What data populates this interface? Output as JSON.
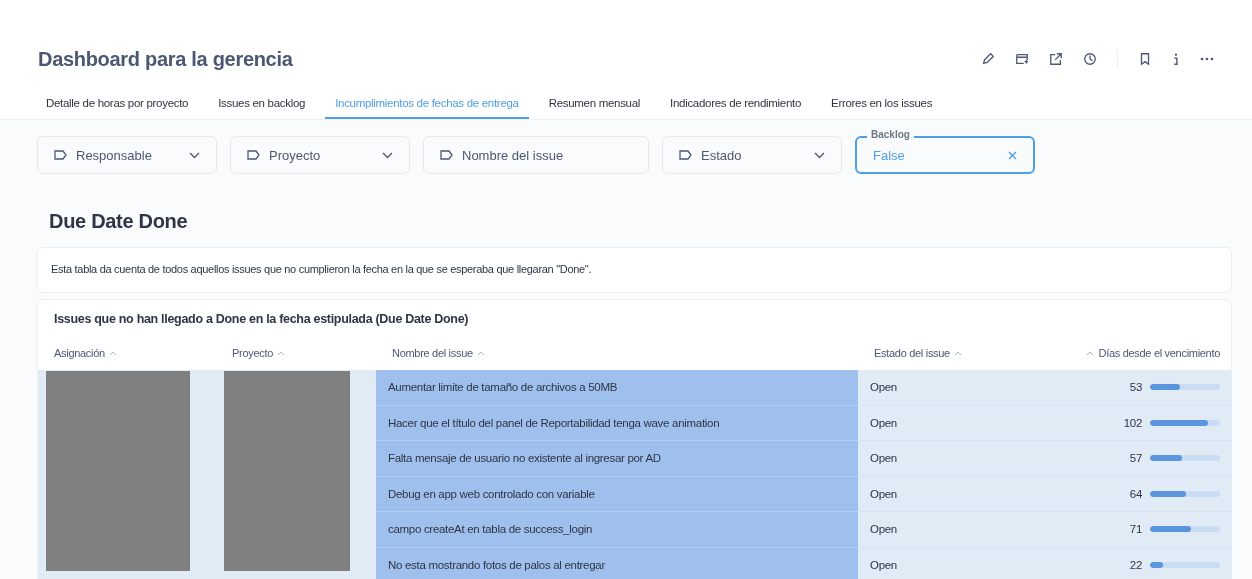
{
  "title": "Dashboard para la gerencia",
  "tabs": [
    {
      "label": "Detalle de horas por proyecto",
      "selected": false
    },
    {
      "label": "Issues en backlog",
      "selected": false
    },
    {
      "label": "Incumplimientos de fechas de entrega",
      "selected": true
    },
    {
      "label": "Resumen mensual",
      "selected": false
    },
    {
      "label": "Indicadores de rendimiento",
      "selected": false
    },
    {
      "label": "Errores en los issues",
      "selected": false
    }
  ],
  "filters": [
    {
      "kind": "dropdown",
      "label": "Responsable"
    },
    {
      "kind": "dropdown",
      "label": "Proyecto"
    },
    {
      "kind": "text",
      "label": "Nombre del issue"
    },
    {
      "kind": "dropdown",
      "label": "Estado"
    },
    {
      "kind": "set",
      "label": "Backlog",
      "value": "False"
    }
  ],
  "section_heading": "Due Date Done",
  "description": "Esta tabla da cuenta de todos aquellos issues que no cumplieron la fecha en la que se esperaba que llegaran \"Done\".",
  "table": {
    "title": "Issues que no han llegado a Done en la fecha estipulada (Due Date Done)",
    "columns": [
      "Asignación",
      "Proyecto",
      "Nombre del issue",
      "Estado del issue",
      "Días desde el vencimiento"
    ],
    "rows": [
      {
        "issue": "Aumentar limite de tamaño de archivos a 50MB",
        "status": "Open",
        "days": "53",
        "level": 0.43
      },
      {
        "issue": "Hacer que el título del panel de Reportabilidad tenga wave animation",
        "status": "Open",
        "days": "102",
        "level": 0.83
      },
      {
        "issue": "Falta mensaje de usuario no existente al ingresar por AD",
        "status": "Open",
        "days": "57",
        "level": 0.46
      },
      {
        "issue": "Debug en app web controlado con variable",
        "status": "Open",
        "days": "64",
        "level": 0.52
      },
      {
        "issue": "campo createAt en tabla de success_login",
        "status": "Open",
        "days": "71",
        "level": 0.58
      },
      {
        "issue": "No esta mostrando fotos de palos al entregar",
        "status": "Open",
        "days": "22",
        "level": 0.18
      }
    ]
  }
}
